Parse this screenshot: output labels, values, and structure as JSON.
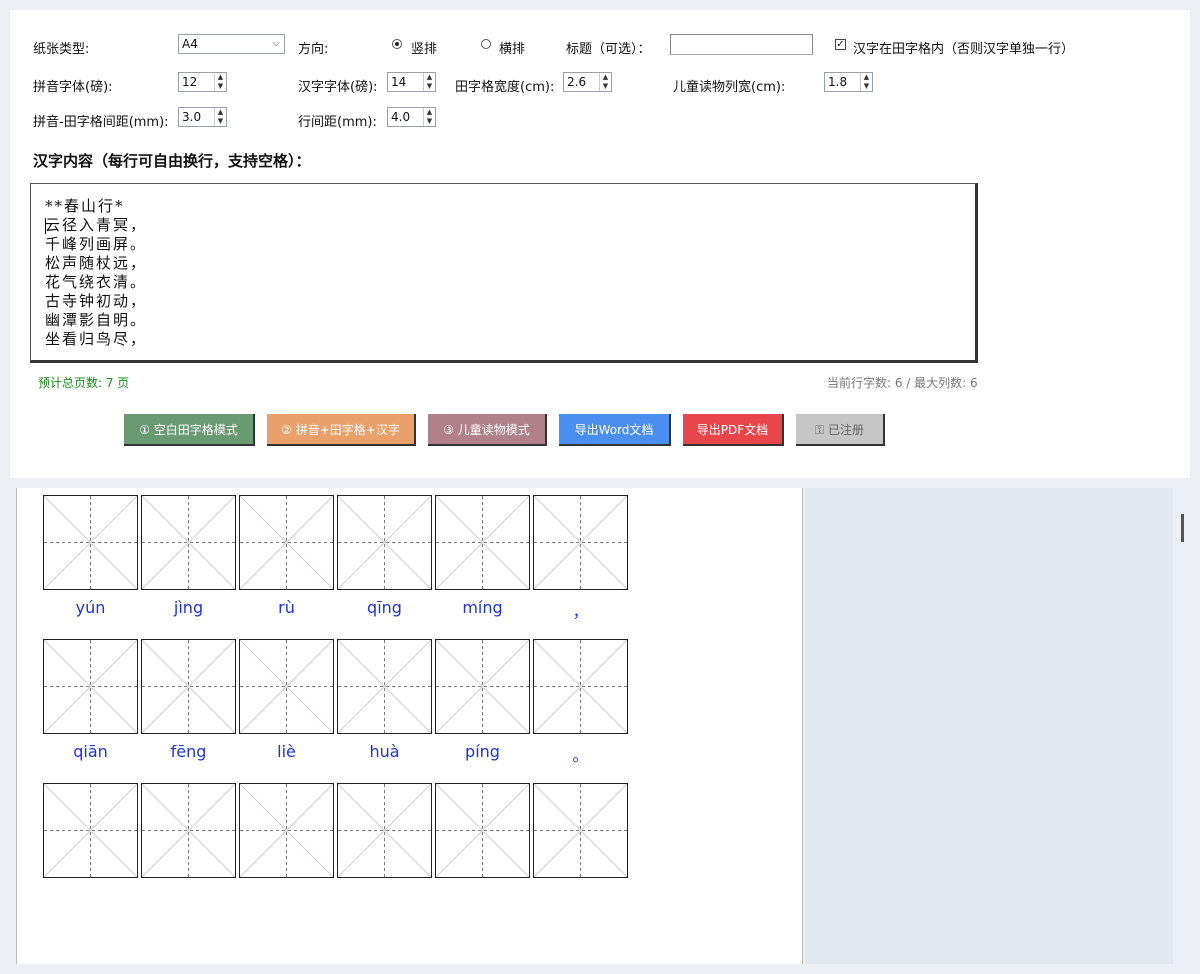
{
  "settings": {
    "paper_label": "纸张类型:",
    "paper_value": "A4",
    "direction_label": "方向:",
    "direction_vertical": "竖排",
    "direction_horizontal": "横排",
    "title_label": "标题（可选）：",
    "title_value": "",
    "hanzi_in_grid_label": "汉字在田字格内（否则汉字单独一行）",
    "pinyin_font_label": "拼音字体(磅):",
    "pinyin_font_value": "12",
    "hanzi_font_label": "汉字字体(磅):",
    "hanzi_font_value": "14",
    "grid_width_label": "田字格宽度(cm):",
    "grid_width_value": "2.6",
    "child_col_label": "儿童读物列宽(cm):",
    "child_col_value": "1.8",
    "spacing_label": "拼音-田字格间距(mm):",
    "spacing_value": "3.0",
    "line_spacing_label": "行间距(mm):",
    "line_spacing_value": "4.0"
  },
  "content": {
    "heading": "汉字内容（每行可自由换行，支持空格）：",
    "lines": [
      "**春山行*",
      "云径入青冥，",
      "千峰列画屏。",
      "松声随杖远，",
      "花气绕衣清。",
      "古寺钟初动，",
      "幽潭影自明。",
      "坐看归鸟尽，"
    ],
    "page_estimate": "预计总页数: 7 页",
    "row_info": "当前行字数: 6 / 最大列数: 6"
  },
  "buttons": [
    {
      "label": "① 空白田字格模式",
      "color": "#6a9a72"
    },
    {
      "label": "② 拼音+田字格+汉字",
      "color": "#e9a06a"
    },
    {
      "label": "③ 儿童读物模式",
      "color": "#b0818a"
    },
    {
      "label": "导出Word文档",
      "color": "#4a8ef0"
    },
    {
      "label": "导出PDF文档",
      "color": "#e8464a"
    },
    {
      "label": "已注册",
      "color": "#c6c6c6"
    }
  ],
  "preview": {
    "rows": [
      [
        "yún",
        "jìng",
        "rù",
        "qīng",
        "míng",
        "，"
      ],
      [
        "qiān",
        "fēng",
        "liè",
        "huà",
        "píng",
        "。"
      ],
      [
        "",
        "",
        "",
        "",
        "",
        ""
      ]
    ]
  },
  "colors": {
    "pinyin": "#1f33d6",
    "preview_bg": "#e1e8f0"
  }
}
